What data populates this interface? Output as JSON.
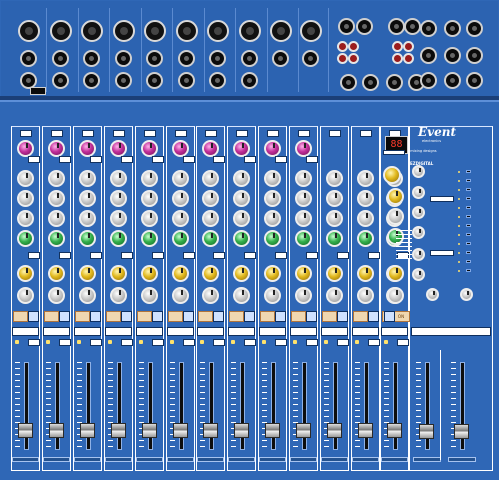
{
  "brand": {
    "logo": "Event",
    "logo_subtitle": "electronics",
    "tagline": "advanced mixing designs",
    "model": "EZDIGITAL"
  },
  "fx_display": {
    "value": "88"
  },
  "fx_return": {
    "mute_label": "ON"
  },
  "colors": {
    "panel": "#2f67b6",
    "io_panel": "#2c63b1",
    "trim_knob": "#c2309a",
    "eq_mid_knob": "#35b14d",
    "aux_knob": "#e2b91e",
    "mute_button": "#f0d7b0",
    "display_text": "#ff3b2c"
  },
  "icons": {
    "xlr_input": "xlr-connector-icon",
    "line_input": "quarter-inch-jack-icon",
    "rca": "rca-jack-icon",
    "knob": "rotary-knob-icon",
    "fader": "fader-icon"
  }
}
